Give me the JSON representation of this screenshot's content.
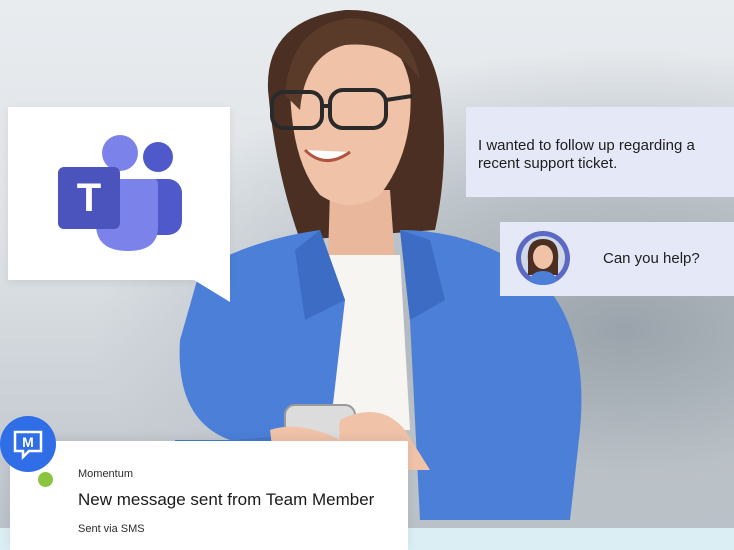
{
  "chat": {
    "message_1": "I wanted to follow up regarding a recent support ticket.",
    "message_2": "Can you help?"
  },
  "notification": {
    "app_name": "Momentum",
    "title": "New message sent from Team Member",
    "subtitle": "Sent via SMS"
  },
  "logos": {
    "teams_letter": "T",
    "app_icon_letters": "M"
  },
  "colors": {
    "teams_purple": "#5059c9",
    "bubble_bg": "#e5e8f6",
    "blazer_blue": "#4b7fd8",
    "app_icon_blue": "#2f6ee6",
    "online_dot": "#8bc53f"
  }
}
